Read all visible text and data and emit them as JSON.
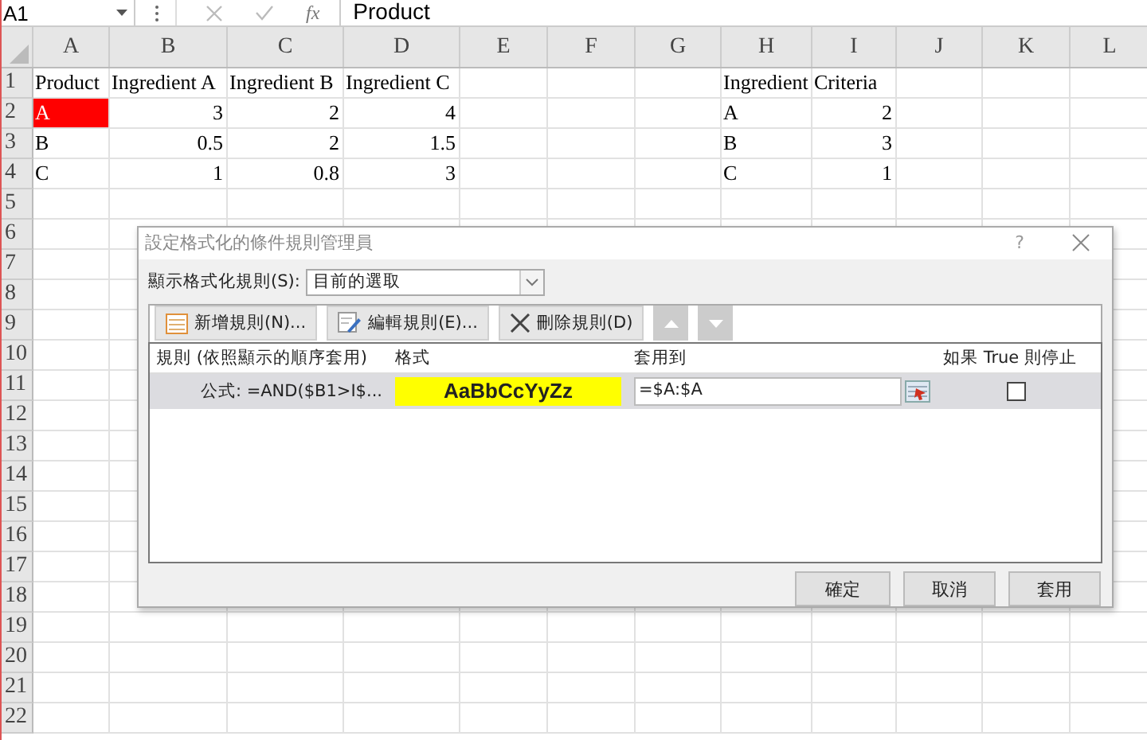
{
  "formula_bar": {
    "name_box": "A1",
    "function_label": "fx",
    "formula": "Product"
  },
  "columns": [
    "A",
    "B",
    "C",
    "D",
    "E",
    "F",
    "G",
    "H",
    "I",
    "J",
    "K",
    "L"
  ],
  "rows": [
    {
      "number": "1",
      "cells": [
        {
          "text": "Product",
          "kind": "text"
        },
        {
          "text": "Ingredient A",
          "kind": "text"
        },
        {
          "text": "Ingredient B",
          "kind": "text"
        },
        {
          "text": "Ingredient C",
          "kind": "text"
        }
      ],
      "criteria_cells": [
        {
          "text": "Ingredient",
          "kind": "text"
        },
        {
          "text": "Criteria",
          "kind": "text"
        }
      ]
    },
    {
      "number": "2",
      "cells": [
        {
          "text": "A",
          "kind": "text",
          "color": "#ff0000"
        },
        {
          "text": "3",
          "kind": "number"
        },
        {
          "text": "2",
          "kind": "number"
        },
        {
          "text": "4",
          "kind": "number"
        }
      ],
      "criteria_cells": [
        {
          "text": "A",
          "kind": "text"
        },
        {
          "text": "2",
          "kind": "number"
        }
      ]
    },
    {
      "number": "3",
      "cells": [
        {
          "text": "B",
          "kind": "text"
        },
        {
          "text": "0.5",
          "kind": "number"
        },
        {
          "text": "2",
          "kind": "number"
        },
        {
          "text": "1.5",
          "kind": "number"
        }
      ],
      "criteria_cells": [
        {
          "text": "B",
          "kind": "text"
        },
        {
          "text": "3",
          "kind": "number"
        }
      ]
    },
    {
      "number": "4",
      "cells": [
        {
          "text": "C",
          "kind": "text"
        },
        {
          "text": "1",
          "kind": "number"
        },
        {
          "text": "0.8",
          "kind": "number"
        },
        {
          "text": "3",
          "kind": "number"
        }
      ],
      "criteria_cells": [
        {
          "text": "C",
          "kind": "text"
        },
        {
          "text": "1",
          "kind": "number"
        }
      ]
    },
    {
      "number": "5"
    },
    {
      "number": "6"
    },
    {
      "number": "7"
    },
    {
      "number": "8"
    },
    {
      "number": "9"
    },
    {
      "number": "10"
    },
    {
      "number": "11"
    },
    {
      "number": "12"
    },
    {
      "number": "13"
    },
    {
      "number": "14"
    },
    {
      "number": "15"
    },
    {
      "number": "16"
    },
    {
      "number": "17"
    },
    {
      "number": "18"
    },
    {
      "number": "19"
    },
    {
      "number": "20"
    },
    {
      "number": "21"
    },
    {
      "number": "22"
    }
  ],
  "dialog": {
    "title": "設定格式化的條件規則管理員",
    "help": "?",
    "show_rules": {
      "label": "顯示格式化規則(S):",
      "value": "目前的選取"
    },
    "toolbar": [
      {
        "kind": "new",
        "label": "新增規則(N)..."
      },
      {
        "kind": "edit",
        "label": "編輯規則(E)..."
      },
      {
        "kind": "delete",
        "label": "刪除規則(D)"
      },
      {
        "kind": "up",
        "disabled": true
      },
      {
        "kind": "down",
        "disabled": true
      }
    ],
    "columns": [
      "規則 (依照顯示的順序套用)",
      "格式",
      "套用到",
      "如果 True 則停止"
    ],
    "rules": [
      {
        "rule": "公式: =AND($B1>I$...",
        "preview": "AaBbCcYyZz",
        "color": "#ffff00",
        "applies_to": "=$A:$A",
        "stop_if_true": false,
        "selected": true
      }
    ],
    "buttons": [
      "確定",
      "取消",
      "套用"
    ]
  }
}
